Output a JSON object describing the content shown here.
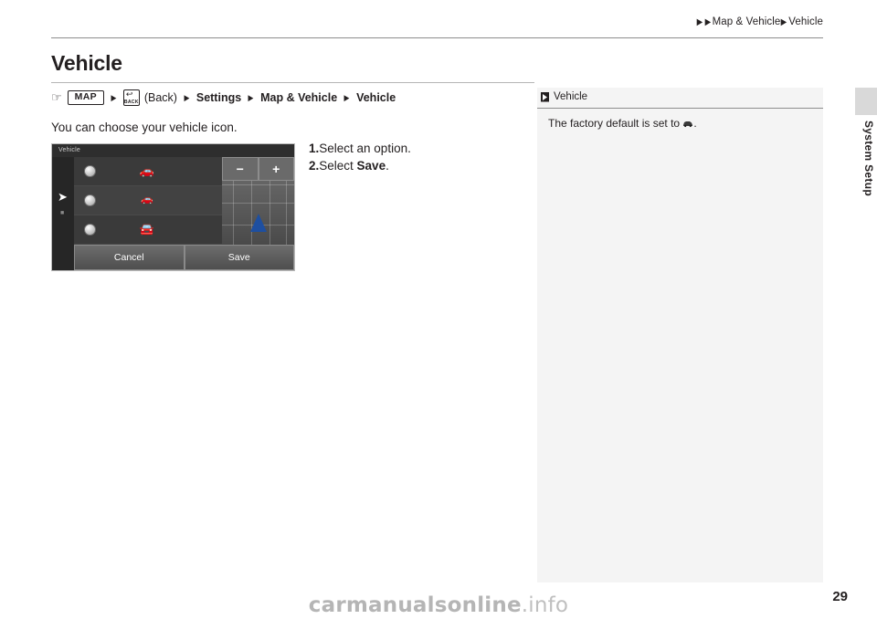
{
  "header": {
    "breadcrumb": [
      "Map & Vehicle",
      "Vehicle"
    ],
    "arrow_glyph": "▶"
  },
  "side": {
    "label": "System Setup"
  },
  "page": {
    "title": "Vehicle",
    "number": "29"
  },
  "nav_path": {
    "hand_icon": "☞",
    "map_key": "MAP",
    "back_key_label": "BACK",
    "back_paren": "(Back)",
    "items": [
      "Settings",
      "Map & Vehicle",
      "Vehicle"
    ],
    "separator": "▶"
  },
  "body": {
    "intro": "You can choose your vehicle icon.",
    "steps": [
      {
        "num": "1.",
        "text": "Select an option."
      },
      {
        "num": "2.",
        "text_prefix": "Select ",
        "bold": "Save",
        "text_suffix": "."
      }
    ]
  },
  "figure": {
    "title": "Vehicle",
    "zoom_out": "−",
    "zoom_in": "+",
    "cancel": "Cancel",
    "save": "Save",
    "car_icons": [
      "car-icon-1",
      "car-icon-2",
      "car-icon-3"
    ],
    "radio_name": "option-radio"
  },
  "note": {
    "head": "Vehicle",
    "body_prefix": "The factory default is set to ",
    "body_suffix": "."
  },
  "watermark": {
    "text_main": "carmanualsonline",
    "text_suffix": ".info"
  },
  "colors": {
    "text": "#231f20",
    "rule": "#8d8d8d",
    "note_bg": "#f4f4f4",
    "tab": "#d9d9d9",
    "vehicle_marker": "#1e4fa0"
  }
}
